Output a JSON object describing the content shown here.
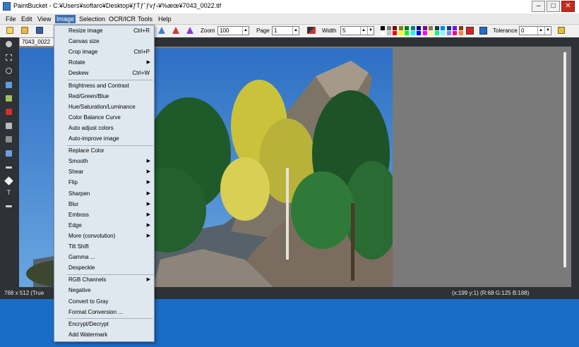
{
  "window": {
    "title": "PaintBucket - C:¥Users¥softaro¥Desktop¥ƒTƒˆƒvƒ‹¥%æœ¥7043_0022.tif",
    "minimize": "–",
    "maximize": "□",
    "close": "✕"
  },
  "menubar": [
    "File",
    "Edit",
    "View",
    "Image",
    "Selection",
    "OCR/ICR",
    "Tools",
    "Help"
  ],
  "toolbar": {
    "zoom_label": "Zoom",
    "zoom_value": "100",
    "page_label": "Page",
    "page_value": "1",
    "width_label": "Width",
    "width_value": "5",
    "tolerance_label": "Tolerance",
    "tolerance_value": "0",
    "palette": [
      "#000000",
      "#808080",
      "#800000",
      "#808000",
      "#008000",
      "#008080",
      "#000080",
      "#800080",
      "#808040",
      "#004040",
      "#0080ff",
      "#004080",
      "#8000ff",
      "#804000",
      "#ffffff",
      "#c0c0c0",
      "#ff0000",
      "#ffff00",
      "#00ff00",
      "#00ffff",
      "#0000ff",
      "#ff00ff",
      "#ffff80",
      "#00ff80",
      "#80ffff",
      "#8080ff",
      "#ff0080",
      "#ff8040"
    ],
    "primary_color": "#e02020",
    "secondary_color": "#1f6fd0"
  },
  "document_tab": "7043_0022",
  "status": {
    "left": "768 x 512  (True",
    "right": "(x:199  y:1) (R:68 G:125 B:188)"
  },
  "image_menu": {
    "items": [
      {
        "label": "Resize image",
        "shortcut": "Ctrl+R"
      },
      {
        "label": "Canvas size"
      },
      {
        "label": "Crop image",
        "shortcut": "Ctrl+P"
      },
      {
        "label": "Rotate",
        "submenu": true
      },
      {
        "label": "Deskew",
        "shortcut": "Ctrl+W"
      },
      {
        "label": "Brightness and Contrast"
      },
      {
        "label": "Red/Green/Blue"
      },
      {
        "label": "Hue/Saturation/Luminance"
      },
      {
        "label": "Color Balance Curve"
      },
      {
        "label": "Auto adjust colors"
      },
      {
        "label": "Auto-improve image"
      },
      {
        "label": "Replace Color"
      },
      {
        "label": "Smooth",
        "submenu": true
      },
      {
        "label": "Shear",
        "submenu": true
      },
      {
        "label": "Flip",
        "submenu": true
      },
      {
        "label": "Sharpen",
        "submenu": true
      },
      {
        "label": "Blur",
        "submenu": true
      },
      {
        "label": "Emboss",
        "submenu": true
      },
      {
        "label": "Edge",
        "submenu": true
      },
      {
        "label": "More (convolution)",
        "submenu": true
      },
      {
        "label": "Tilt Shift"
      },
      {
        "label": "Gamma ..."
      },
      {
        "label": "Despeckle"
      },
      {
        "label": "RGB Channels",
        "submenu": true
      },
      {
        "label": "Negative"
      },
      {
        "label": "Convert to Gray"
      },
      {
        "label": "Format Conversion ..."
      },
      {
        "label": "Encrypt/Decrypt"
      },
      {
        "label": "Add Watermark"
      }
    ]
  }
}
